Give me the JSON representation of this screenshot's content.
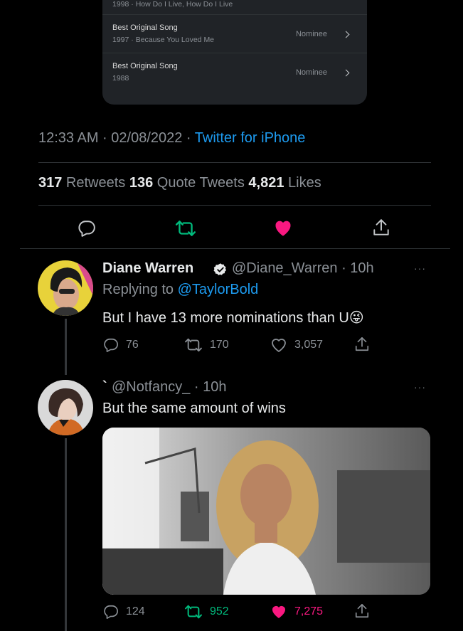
{
  "embed_card": {
    "rows": [
      {
        "title": "",
        "subtitle": "1998 · How Do I Live, How Do I Live",
        "status": ""
      },
      {
        "title": "Best Original Song",
        "subtitle": "1997 · Because You Loved Me",
        "status": "Nominee"
      },
      {
        "title": "Best Original Song",
        "subtitle": "1988",
        "status": "Nominee"
      }
    ]
  },
  "main_tweet": {
    "timestamp": "12:33 AM · 02/08/2022 · ",
    "source": "Twitter for iPhone",
    "retweets_count": "317",
    "retweets_label": " Retweets ",
    "quotes_count": "136",
    "quotes_label": " Quote Tweets ",
    "likes_count": "4,821",
    "likes_label": " Likes"
  },
  "reply1": {
    "name": "Diane Warren",
    "handle": "@Diane_Warren · 10h",
    "replying_prefix": "Replying to ",
    "replying_to": "@TaylorBold",
    "text": "But I have 13 more nominations than U",
    "emoji": "😜",
    "replies": "76",
    "retweets": "170",
    "likes": "3,057"
  },
  "reply2": {
    "name": "`",
    "handle": "@Notfancy_ · 10h",
    "text": "But the same amount of wins",
    "replies": "124",
    "retweets": "952",
    "likes": "7,275"
  },
  "more_glyph": "···",
  "colors": {
    "background": "#000000",
    "link": "#1d9bf0",
    "retweet_active": "#00ba7c",
    "like_active": "#f91880",
    "muted": "#8b9096"
  },
  "icons": [
    "reply-icon",
    "retweet-icon",
    "heart-icon",
    "share-icon",
    "verified-badge-icon",
    "chevron-right-icon",
    "more-icon"
  ]
}
